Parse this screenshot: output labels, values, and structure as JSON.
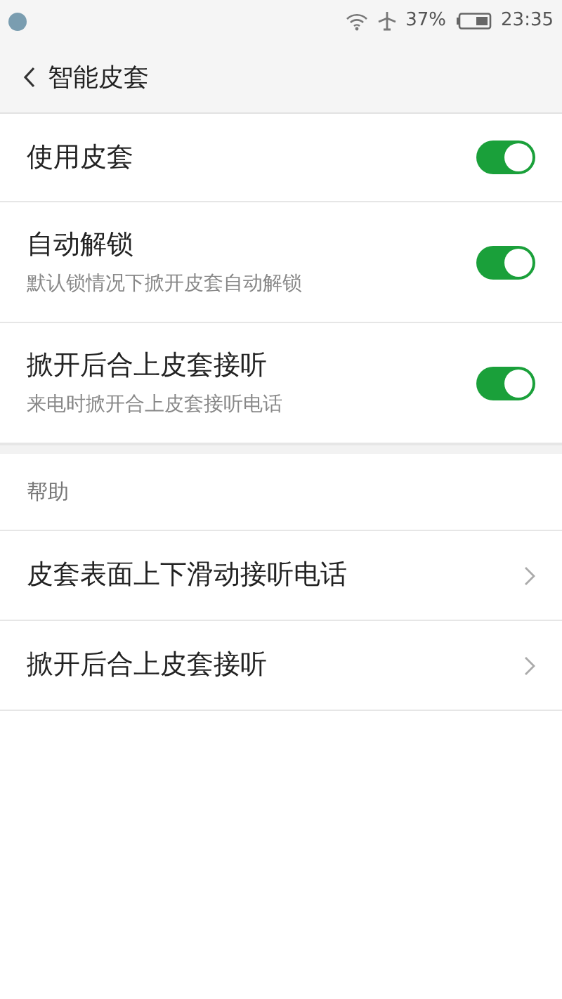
{
  "status_bar": {
    "battery_percent": "37%",
    "time": "23:35"
  },
  "header": {
    "title": "智能皮套"
  },
  "settings": [
    {
      "title": "使用皮套",
      "on": true
    },
    {
      "title": "自动解锁",
      "subtitle": "默认锁情况下掀开皮套自动解锁",
      "on": true
    },
    {
      "title": "掀开后合上皮套接听",
      "subtitle": "来电时掀开合上皮套接听电话",
      "on": true
    }
  ],
  "help": {
    "heading": "帮助",
    "items": [
      {
        "title": "皮套表面上下滑动接听电话"
      },
      {
        "title": "掀开后合上皮套接听"
      }
    ]
  }
}
